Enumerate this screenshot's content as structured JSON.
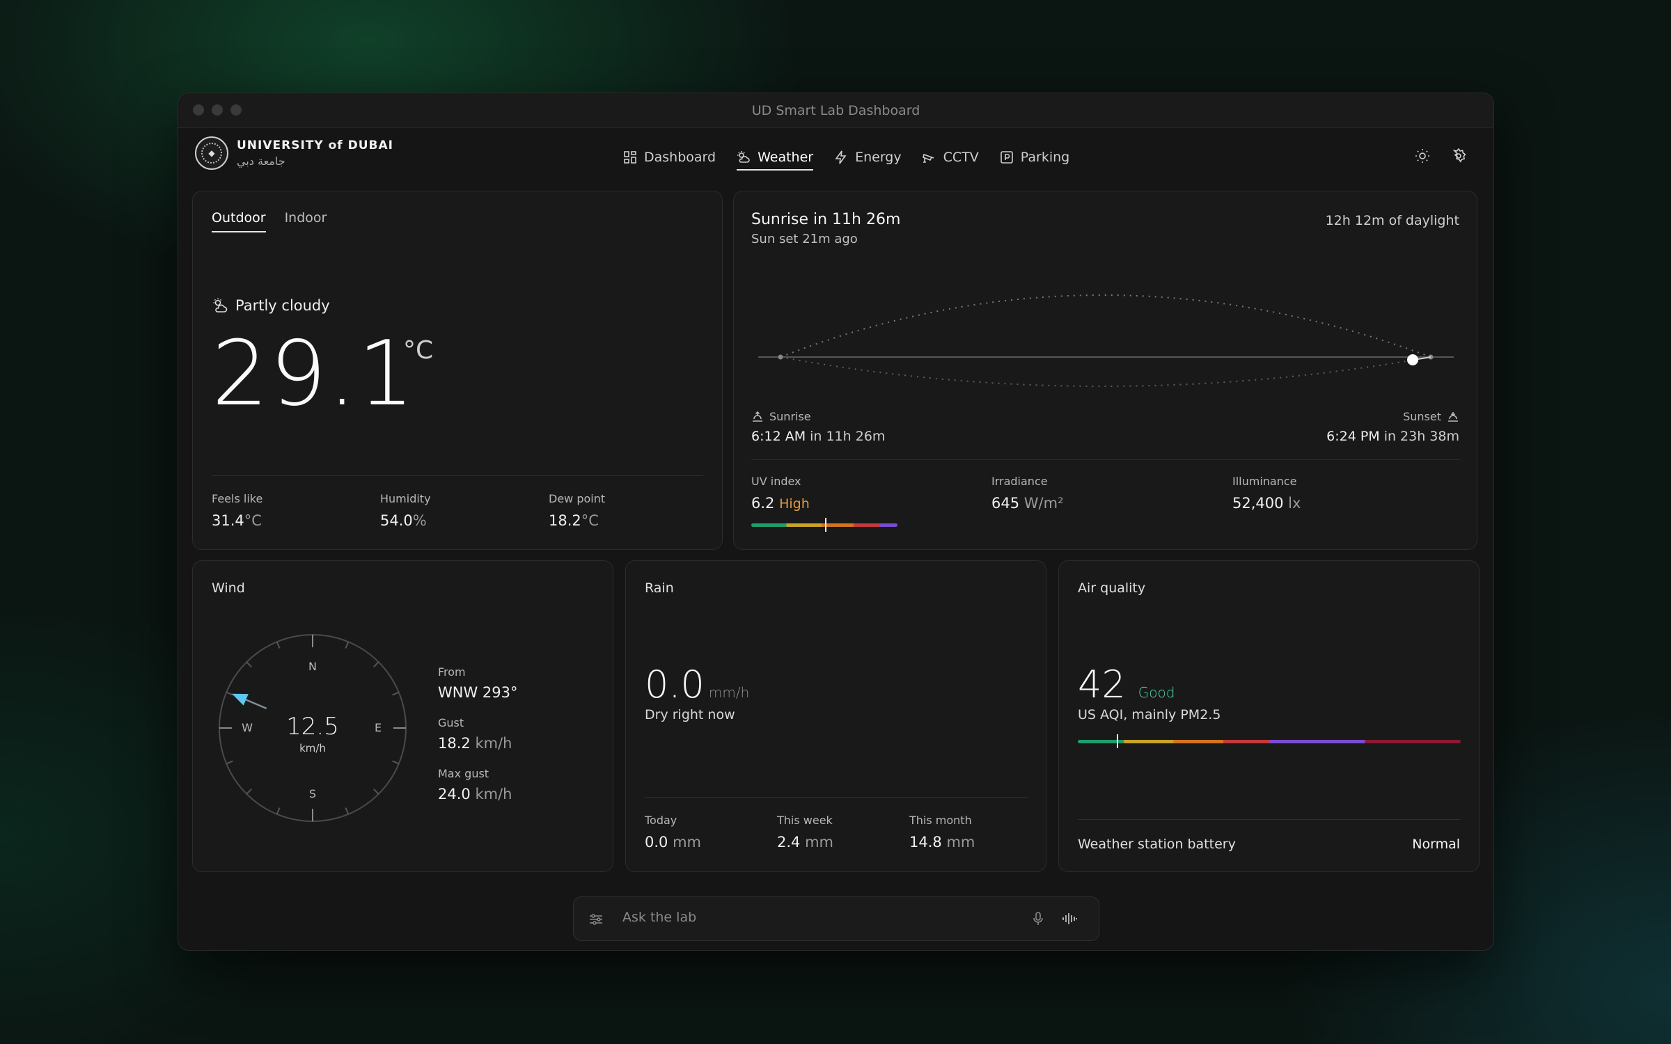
{
  "window": {
    "title": "UD Smart Lab Dashboard"
  },
  "brand": {
    "name_en": "UNIVERSITY of DUBAI",
    "name_ar": "جامعة دبي"
  },
  "nav": [
    {
      "label": "Dashboard",
      "icon": "grid-icon"
    },
    {
      "label": "Weather",
      "icon": "weather-icon",
      "active": true
    },
    {
      "label": "Energy",
      "icon": "bolt-icon"
    },
    {
      "label": "CCTV",
      "icon": "camera-icon"
    },
    {
      "label": "Parking",
      "icon": "parking-icon"
    }
  ],
  "outdoor": {
    "tabs": [
      "Outdoor",
      "Indoor"
    ],
    "active_tab": "Outdoor",
    "condition": "Partly cloudy",
    "temperature": "29.1",
    "temp_unit": "°C",
    "stats": [
      {
        "label": "Feels like",
        "value": "31.4",
        "unit": "°C"
      },
      {
        "label": "Humidity",
        "value": "54.0",
        "unit": "%"
      },
      {
        "label": "Dew point",
        "value": "18.2",
        "unit": "°C"
      }
    ]
  },
  "sun": {
    "title": "Sunrise in 11h 26m",
    "subtitle": "Sun set 21m ago",
    "daylight": "12h 12m of daylight",
    "sunrise": {
      "label": "Sunrise",
      "time": "6:12 AM",
      "relative": "in 11h 26m"
    },
    "sunset": {
      "label": "Sunset",
      "time": "6:24 PM",
      "relative": "in 23h 38m"
    },
    "uv": {
      "label": "UV index",
      "value": "6.2",
      "level": "High",
      "level_color": "#e39b3c"
    },
    "irradiance": {
      "label": "Irradiance",
      "value": "645",
      "unit": "W/m²"
    },
    "illuminance": {
      "label": "Illuminance",
      "value": "52,400",
      "unit": "lx"
    }
  },
  "wind": {
    "title": "Wind",
    "speed": "12.5",
    "speed_unit": "km/h",
    "cardinals": {
      "n": "N",
      "e": "E",
      "s": "S",
      "w": "W"
    },
    "direction_deg": 293,
    "arrow_color": "#5cc8f0",
    "from_label": "From",
    "from_value": "WNW 293°",
    "gust_label": "Gust",
    "gust_value": "18.2",
    "gust_unit": "km/h",
    "maxgust_label": "Max gust",
    "maxgust_value": "24.0",
    "maxgust_unit": "km/h"
  },
  "rain": {
    "title": "Rain",
    "rate": "0.0",
    "rate_unit": "mm/h",
    "status": "Dry right now",
    "totals": [
      {
        "label": "Today",
        "value": "0.0",
        "unit": "mm"
      },
      {
        "label": "This week",
        "value": "2.4",
        "unit": "mm"
      },
      {
        "label": "This month",
        "value": "14.8",
        "unit": "mm"
      }
    ]
  },
  "air": {
    "title": "Air quality",
    "aqi": "42",
    "level": "Good",
    "level_color": "#4fd6a4",
    "subtitle": "US AQI, mainly PM2.5",
    "battery_label": "Weather station battery",
    "battery_value": "Normal"
  },
  "ask": {
    "placeholder": "Ask the lab"
  }
}
